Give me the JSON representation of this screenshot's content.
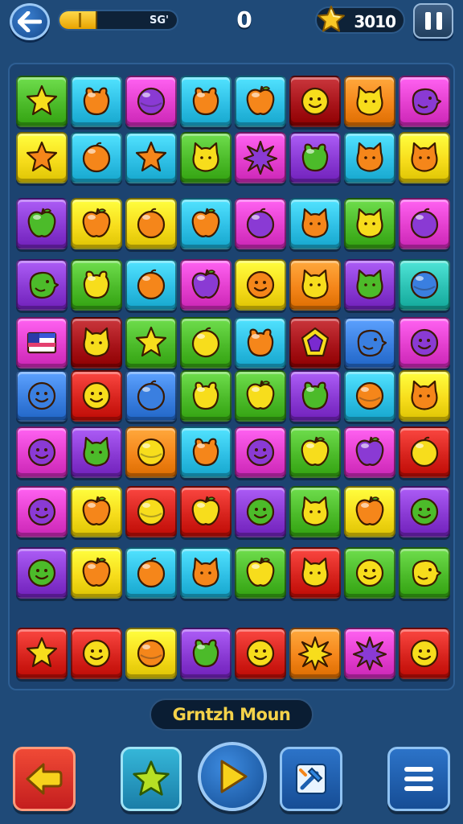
{
  "header": {
    "progress_label": "SG'",
    "progress_fraction": 0.32,
    "moves": "0",
    "score": "3010"
  },
  "banner": {
    "label": "Grntzh Moun"
  },
  "colors": {
    "green": "#4cbb2a",
    "cyan": "#2fc0e6",
    "magenta": "#e43fcf",
    "red": "#d8241e",
    "orange": "#f5861a",
    "yellow": "#f7dd1c",
    "purple": "#8a3ad4",
    "blue": "#3a7fe0",
    "darkred": "#a8141a",
    "teal": "#2cc2b4"
  },
  "board": {
    "rows": [
      [
        [
          "green",
          "star"
        ],
        [
          "cyan",
          "bear"
        ],
        [
          "magenta",
          "ball"
        ],
        [
          "cyan",
          "bear"
        ],
        [
          "cyan",
          "apple"
        ],
        [
          "darkred",
          "face"
        ],
        [
          "orange",
          "cat"
        ],
        [
          "magenta",
          "bird"
        ]
      ],
      [
        [
          "yellow",
          "star"
        ],
        [
          "cyan",
          "fruit"
        ],
        [
          "cyan",
          "star"
        ],
        [
          "green",
          "cat"
        ],
        [
          "magenta",
          "burst"
        ],
        [
          "purple",
          "bear"
        ],
        [
          "cyan",
          "cat"
        ],
        [
          "yellow",
          "cat"
        ]
      ],
      [
        [
          "purple",
          "apple"
        ],
        [
          "yellow",
          "apple"
        ],
        [
          "yellow",
          "fruit"
        ],
        [
          "cyan",
          "apple"
        ],
        [
          "magenta",
          "fruit"
        ],
        [
          "cyan",
          "cat"
        ],
        [
          "green",
          "cat"
        ],
        [
          "magenta",
          "fruit"
        ]
      ],
      [
        [
          "purple",
          "bird"
        ],
        [
          "green",
          "bear"
        ],
        [
          "cyan",
          "fruit"
        ],
        [
          "magenta",
          "apple"
        ],
        [
          "yellow",
          "face"
        ],
        [
          "orange",
          "cat"
        ],
        [
          "purple",
          "cat"
        ],
        [
          "teal",
          "ball"
        ]
      ],
      [
        [
          "magenta",
          "flag"
        ],
        [
          "darkred",
          "cat"
        ],
        [
          "green",
          "star"
        ],
        [
          "green",
          "fruit"
        ],
        [
          "cyan",
          "bear"
        ],
        [
          "darkred",
          "gem"
        ],
        [
          "blue",
          "bird"
        ],
        [
          "magenta",
          "face"
        ]
      ],
      [
        [
          "blue",
          "face"
        ],
        [
          "red",
          "face"
        ],
        [
          "blue",
          "fruit"
        ],
        [
          "green",
          "bear"
        ],
        [
          "green",
          "apple"
        ],
        [
          "purple",
          "bear"
        ],
        [
          "cyan",
          "ball"
        ],
        [
          "yellow",
          "cat"
        ]
      ],
      [
        [
          "magenta",
          "face"
        ],
        [
          "purple",
          "cat"
        ],
        [
          "orange",
          "ball"
        ],
        [
          "cyan",
          "bear"
        ],
        [
          "magenta",
          "face"
        ],
        [
          "green",
          "apple"
        ],
        [
          "magenta",
          "apple"
        ],
        [
          "red",
          "fruit"
        ]
      ],
      [
        [
          "magenta",
          "face"
        ],
        [
          "yellow",
          "apple"
        ],
        [
          "red",
          "ball"
        ],
        [
          "red",
          "apple"
        ],
        [
          "purple",
          "face"
        ],
        [
          "green",
          "cat"
        ],
        [
          "yellow",
          "apple"
        ],
        [
          "purple",
          "face"
        ]
      ],
      [
        [
          "purple",
          "face"
        ],
        [
          "yellow",
          "apple"
        ],
        [
          "cyan",
          "fruit"
        ],
        [
          "cyan",
          "cat"
        ],
        [
          "green",
          "apple"
        ],
        [
          "red",
          "cat"
        ],
        [
          "green",
          "face"
        ],
        [
          "green",
          "bird"
        ]
      ],
      [
        [
          "red",
          "star"
        ],
        [
          "red",
          "face"
        ],
        [
          "yellow",
          "ball"
        ],
        [
          "purple",
          "bear"
        ],
        [
          "red",
          "face"
        ],
        [
          "orange",
          "burst"
        ],
        [
          "magenta",
          "burst"
        ],
        [
          "red",
          "face"
        ]
      ]
    ]
  },
  "icons": {
    "back": "arrow-left-icon",
    "pause": "pause-icon",
    "score": "star-icon",
    "left": "arrow-left-icon",
    "star": "star-icon",
    "play": "play-icon",
    "tool": "hammer-icon",
    "menu": "menu-icon"
  }
}
